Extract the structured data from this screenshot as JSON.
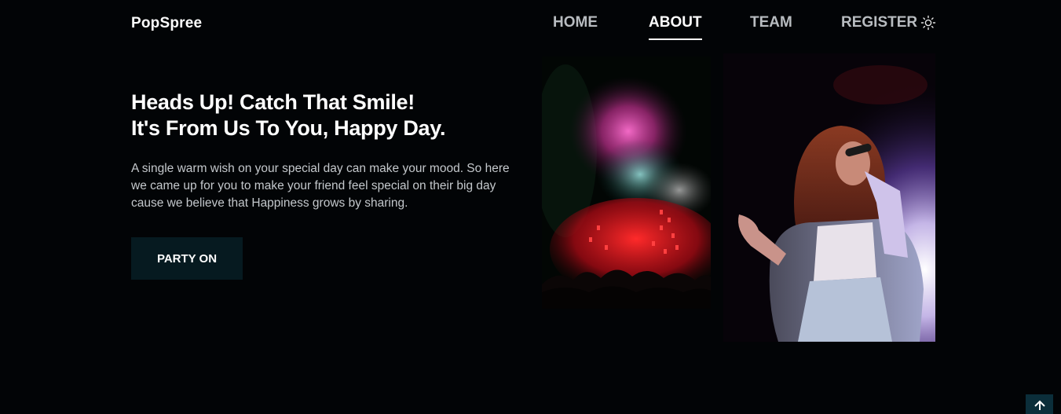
{
  "header": {
    "brand": "PopSpree",
    "nav": [
      {
        "label": "HOME"
      },
      {
        "label": "ABOUT"
      },
      {
        "label": "TEAM"
      },
      {
        "label": "REGISTER"
      }
    ],
    "active_nav": "ABOUT",
    "theme_toggle_icon": "sun-icon"
  },
  "hero": {
    "title_line1": "Heads Up! Catch That Smile!",
    "title_line2": "It's From Us To You, Happy Day.",
    "description": "A single warm wish on your special day can make your mood. So here we came up for you to make your friend feel special on their big day cause we believe that Happiness grows by sharing.",
    "cta_label": "PARTY ON"
  },
  "images": [
    {
      "name": "fireworks-concert-photo"
    },
    {
      "name": "singer-on-stage-photo"
    }
  ],
  "scroll_top_icon": "arrow-up-icon",
  "colors": {
    "background": "#020406",
    "cta_background": "#061a20",
    "scroll_top_background": "#0b2e3a",
    "nav_inactive": "#b8bcc0"
  }
}
